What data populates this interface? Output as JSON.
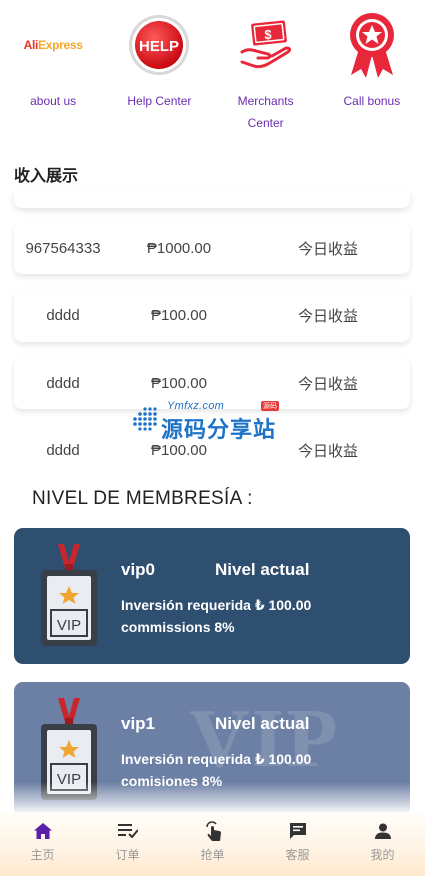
{
  "quick_links": [
    {
      "label": "about us",
      "icon": "aliexpress-logo",
      "logo_text": "AliExpress"
    },
    {
      "label": "Help Center",
      "icon": "help-icon",
      "logo_text": "HELP"
    },
    {
      "label": "Merchants Center",
      "icon": "money-hand-icon",
      "logo_text": "$"
    },
    {
      "label": "Call bonus",
      "icon": "award-ribbon-icon"
    }
  ],
  "income": {
    "title": "收入展示",
    "rows": [
      {
        "user": "967564333",
        "amount": "₱1000.00",
        "label": "今日收益"
      },
      {
        "user": "dddd",
        "amount": "₱100.00",
        "label": "今日收益"
      },
      {
        "user": "dddd",
        "amount": "₱100.00",
        "label": "今日收益"
      },
      {
        "user": "dddd",
        "amount": "₱100.00",
        "label": "今日收益"
      }
    ]
  },
  "watermark": {
    "small": "Ymfxz.com",
    "badge": "源码",
    "big": "源码分享站"
  },
  "membership": {
    "title": "NIVEL DE MEMBRESÍA :",
    "cards": [
      {
        "name": "vip0",
        "level": "Nivel actual",
        "requirement": "Inversión requerida ₺ 100.00",
        "commission": "commissions 8%",
        "badge_text": "VIP",
        "color": "#2f4f70"
      },
      {
        "name": "vip1",
        "level": "Nivel actual",
        "requirement": "Inversión requerida ₺ 100.00",
        "commission": "comisiones 8%",
        "badge_text": "VIP",
        "bg_text": "VIP",
        "color": "#6c7fa4"
      }
    ]
  },
  "nav": {
    "active_color": "#5b1fa8",
    "items": [
      {
        "label": "主页",
        "icon": "home-icon",
        "active": true
      },
      {
        "label": "订单",
        "icon": "order-list-icon"
      },
      {
        "label": "抢单",
        "icon": "tap-hand-icon"
      },
      {
        "label": "客服",
        "icon": "chat-icon"
      },
      {
        "label": "我的",
        "icon": "user-icon"
      }
    ]
  }
}
